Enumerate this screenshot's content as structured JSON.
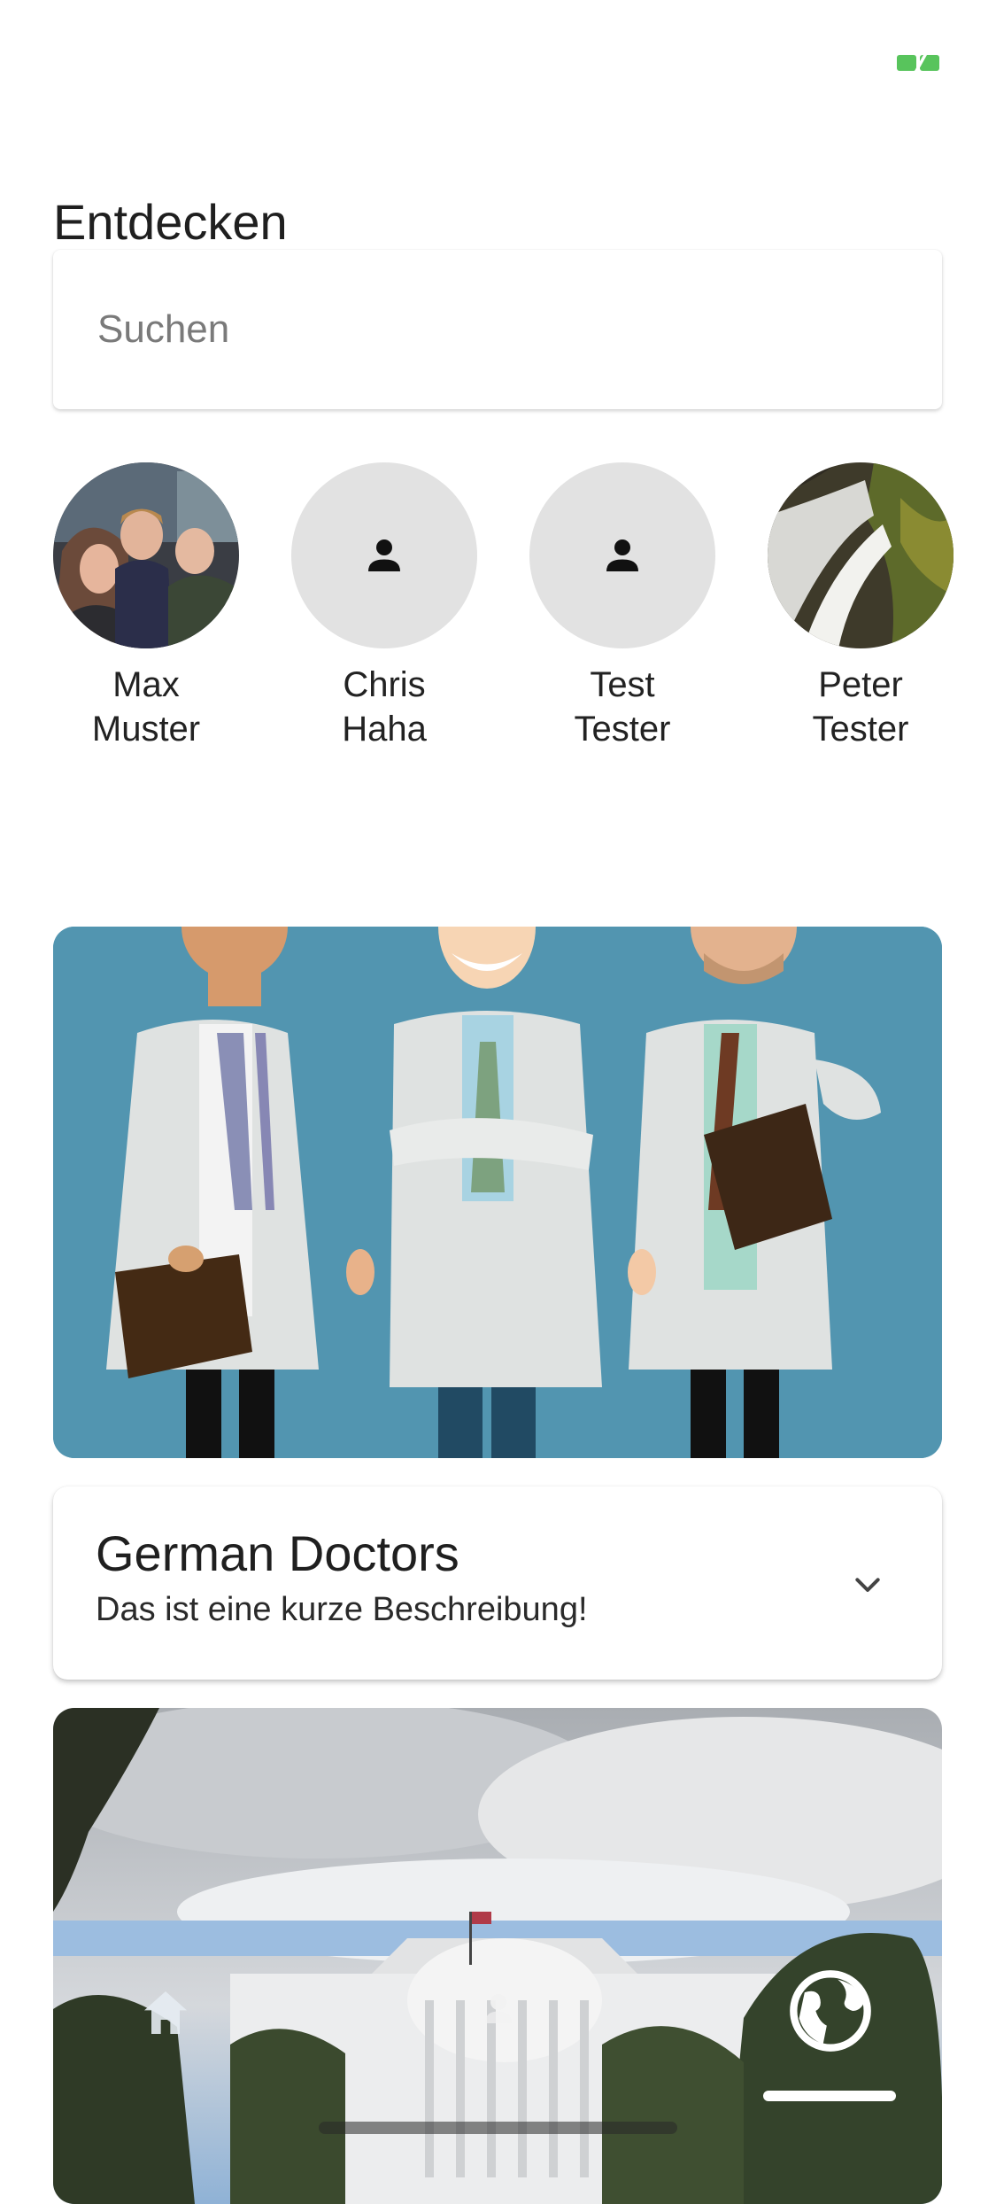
{
  "header": {
    "title": "Entdecken"
  },
  "search": {
    "placeholder": "Suchen",
    "value": ""
  },
  "people": [
    {
      "first": "Max",
      "last": "Muster",
      "avatar": "photo-group"
    },
    {
      "first": "Chris",
      "last": "Haha",
      "avatar": "person-icon"
    },
    {
      "first": "Test",
      "last": "Tester",
      "avatar": "person-icon"
    },
    {
      "first": "Peter",
      "last": "Tester",
      "avatar": "photo-waterfall"
    }
  ],
  "featured": {
    "title": "German Doctors",
    "description": "Das ist eine kurze Beschreibung!",
    "expand_icon": "chevron-down-icon"
  },
  "nav": {
    "items": [
      "home-icon",
      "person-icon",
      "globe-icon"
    ],
    "active": "globe-icon"
  },
  "colors": {
    "accent_battery": "#4cd964",
    "card_bg": "#5295b0"
  }
}
